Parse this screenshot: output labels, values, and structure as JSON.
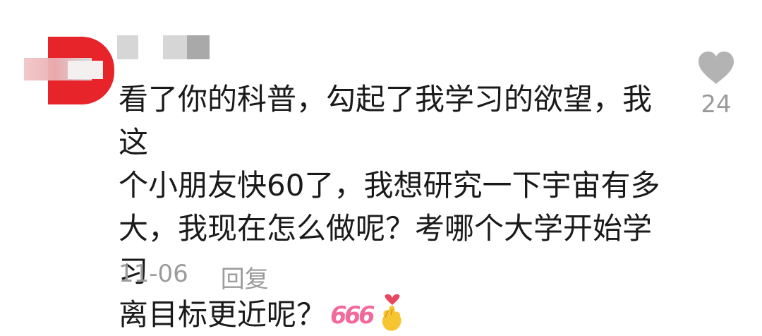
{
  "comment": {
    "text": "看了你的科普，勾起了我学习的欲望，我这\n个小朋友快60了，我想研究一下宇宙有多\n大，我现在怎么做呢？考哪个大学开始学习\n离目标更近呢？",
    "emojis": [
      "666-sticker-icon",
      "finger-heart-icon"
    ],
    "date": "11-06",
    "reply_label": "回复"
  },
  "like": {
    "icon": "heart-outline-icon",
    "count": "24"
  },
  "colors": {
    "avatar_red": "#e8242b",
    "text": "#1a1a1a",
    "meta": "#9b9b9b",
    "like_icon": "#b3b3b3",
    "sticker_pink": "#f06b9b"
  }
}
